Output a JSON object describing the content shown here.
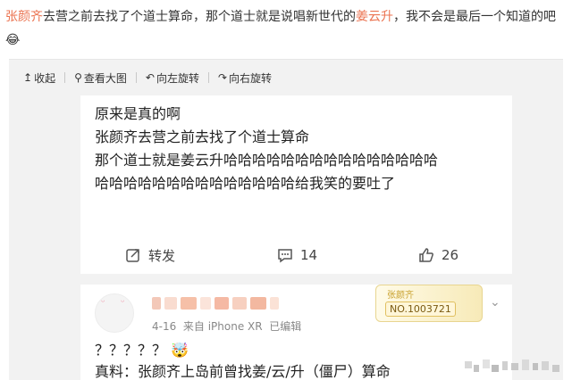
{
  "post": {
    "part1": "张颜齐",
    "part2": "去营之前去找了个道士算命，那个道士就是说唱新世代的",
    "part3": "姜云升",
    "part4": "，我不会是最后一个知道的吧",
    "emoji": "😂"
  },
  "toolbar": {
    "collapse": "收起",
    "view_large": "查看大图",
    "rotate_left": "向左旋转",
    "rotate_right": "向右旋转"
  },
  "card1": {
    "line1": "原来是真的啊",
    "line2": "张颜齐去营之前去找了个道士算命",
    "line3": "那个道士就是姜云升哈哈哈哈哈哈哈哈哈哈哈哈哈哈哈",
    "line4": "哈哈哈哈哈哈哈哈哈哈哈哈哈哈给我笑的要吐了",
    "repost": "转发",
    "comments": "14",
    "likes": "26"
  },
  "card2": {
    "date": "4-16",
    "source": "来自 iPhone XR",
    "edited": "已编辑",
    "fan_name": "张颜齐",
    "fan_no": "NO.1003721",
    "line1": "？？？？？ 🤯",
    "line2": "真料：张颜齐上岛前曾找姜/云/升（僵尸）算命"
  },
  "colors": {
    "link": "#eb7350",
    "bg_gray": "#f2f2f2"
  }
}
